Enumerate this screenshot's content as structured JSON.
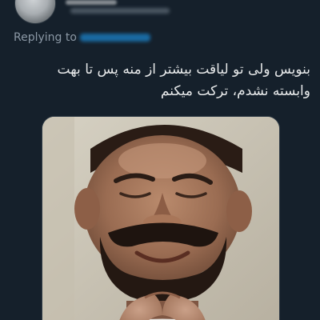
{
  "header": {
    "avatar_icon": "avatar-photo-icon"
  },
  "reply": {
    "prefix": "Replying to"
  },
  "tweet": {
    "lines": [
      "بنویس ولی تو لیاقت بیشتر از منه پس تا بهت",
      "وابسته نشدم، ترکت میکنم"
    ]
  },
  "media": {
    "kind": "photo",
    "icon": "meme-photo-icon"
  },
  "colors": {
    "background": "#15202b",
    "text": "#e7e9ea",
    "secondary_text": "#8b98a5",
    "link": "#1d9bf0"
  }
}
